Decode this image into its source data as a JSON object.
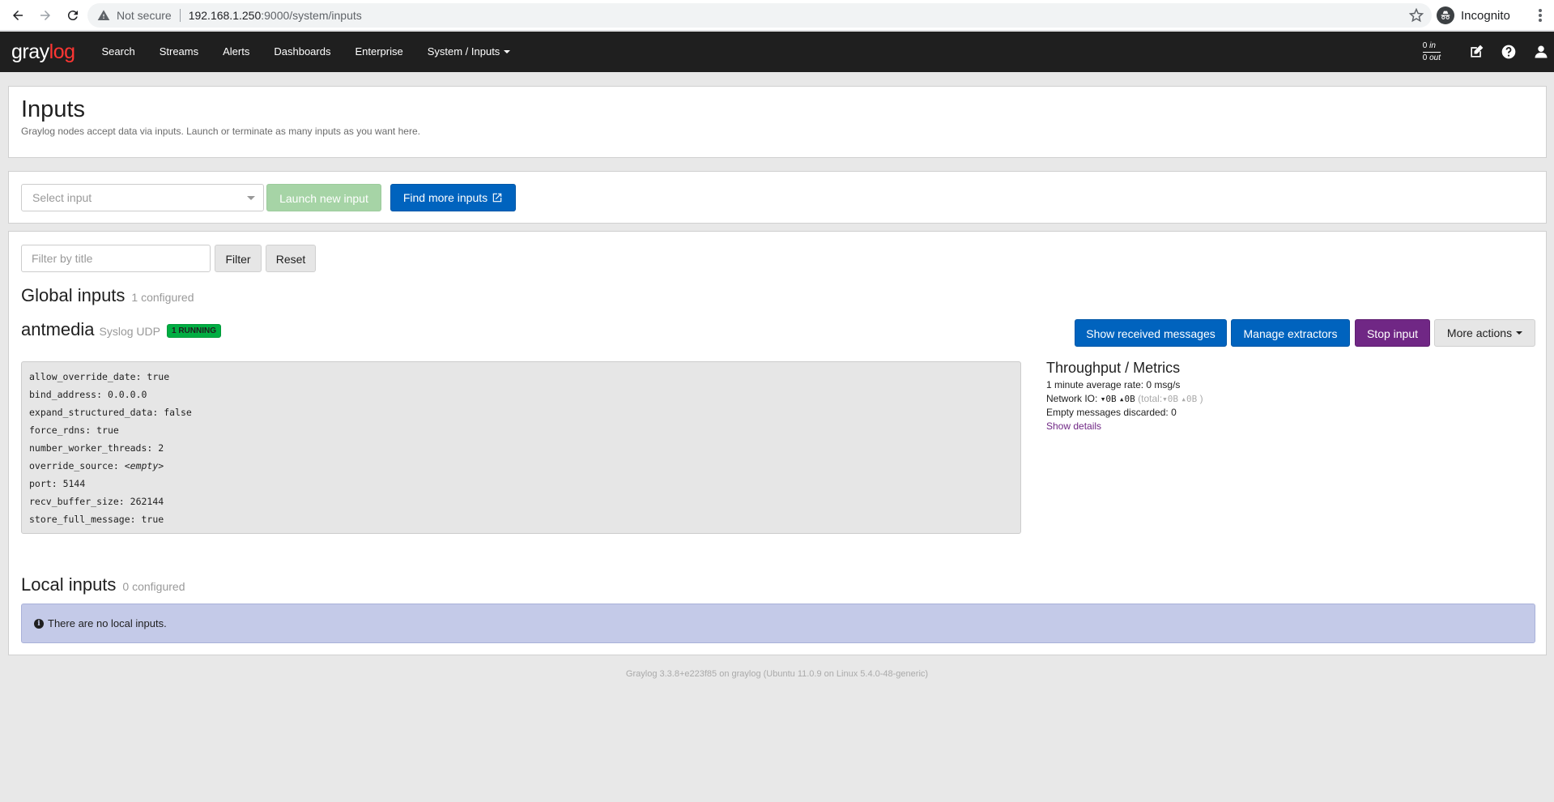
{
  "browser": {
    "security_label": "Not secure",
    "url_host": "192.168.1.250",
    "url_rest": ":9000/system/inputs",
    "profile_label": "Incognito"
  },
  "navbar": {
    "logo_text_a": "gray",
    "logo_text_b": "log",
    "links": [
      {
        "label": "Search"
      },
      {
        "label": "Streams"
      },
      {
        "label": "Alerts"
      },
      {
        "label": "Dashboards"
      },
      {
        "label": "Enterprise"
      },
      {
        "label": "System / Inputs"
      }
    ],
    "throughput_in_value": "0",
    "throughput_in_label": "in",
    "throughput_out_value": "0",
    "throughput_out_label": "out",
    "icons": [
      "edit-icon",
      "help-icon",
      "user-icon"
    ]
  },
  "header": {
    "title": "Inputs",
    "description": "Graylog nodes accept data via inputs. Launch or terminate as many inputs as you want here."
  },
  "launch": {
    "select_placeholder": "Select input",
    "launch_label": "Launch new input",
    "find_label": "Find more inputs"
  },
  "filter": {
    "placeholder": "Filter by title",
    "filter_label": "Filter",
    "reset_label": "Reset"
  },
  "global": {
    "heading": "Global inputs",
    "count": "1 configured",
    "input": {
      "name": "antmedia",
      "type": "Syslog UDP",
      "status": "1 RUNNING",
      "actions": {
        "show": "Show received messages",
        "extractors": "Manage extractors",
        "stop": "Stop input",
        "more": "More actions"
      },
      "config": [
        {
          "key": "allow_override_date",
          "value": "true"
        },
        {
          "key": "bind_address",
          "value": "0.0.0.0"
        },
        {
          "key": "expand_structured_data",
          "value": "false"
        },
        {
          "key": "force_rdns",
          "value": "true"
        },
        {
          "key": "number_worker_threads",
          "value": "2"
        },
        {
          "key": "override_source",
          "value": "<empty>"
        },
        {
          "key": "port",
          "value": "5144"
        },
        {
          "key": "recv_buffer_size",
          "value": "262144"
        },
        {
          "key": "store_full_message",
          "value": "true"
        }
      ],
      "metrics": {
        "title": "Throughput / Metrics",
        "avg_rate": "1 minute average rate: 0 msg/s",
        "network_label": "Network IO:",
        "net_in": "0B",
        "net_out": "0B",
        "total_label": "(total:",
        "total_in": "0B",
        "total_out": "0B",
        "total_close": ")",
        "discarded": "Empty messages discarded: 0",
        "details_link": "Show details"
      }
    }
  },
  "local": {
    "heading": "Local inputs",
    "count": "0 configured",
    "empty_message": "There are no local inputs."
  },
  "footer": {
    "text": "Graylog 3.3.8+e223f85 on graylog (Ubuntu 11.0.9 on Linux 5.4.0-48-generic)"
  },
  "colors": {
    "navbar_bg": "#1f1f1f",
    "primary": "#0063be",
    "success_light": "#a6d4a6",
    "stop": "#702785",
    "running_badge": "#00ae42",
    "info_alert": "#c4cae8",
    "logo_accent": "#ff3633"
  }
}
